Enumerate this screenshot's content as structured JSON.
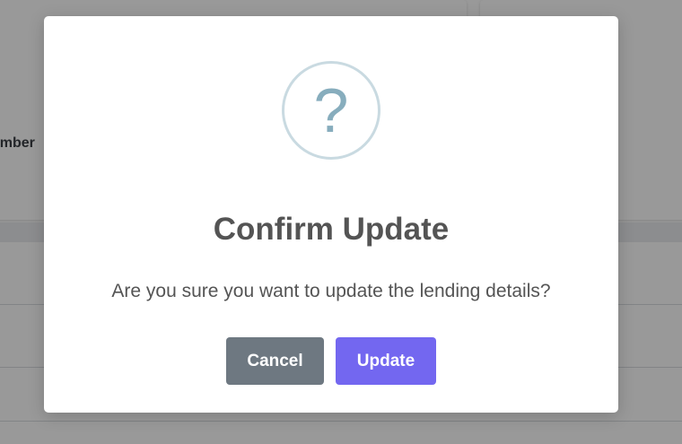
{
  "background": {
    "field_label": "umber"
  },
  "dialog": {
    "icon": "question-icon",
    "icon_glyph": "?",
    "title": "Confirm Update",
    "message": "Are you sure you want to update the lending details?",
    "cancel_label": "Cancel",
    "confirm_label": "Update"
  },
  "colors": {
    "confirm_button": "#7367f0",
    "cancel_button": "#6e7881",
    "icon_border": "#c9dae1",
    "icon_glyph": "#87adbd",
    "overlay": "rgba(0,0,0,0.40)"
  }
}
